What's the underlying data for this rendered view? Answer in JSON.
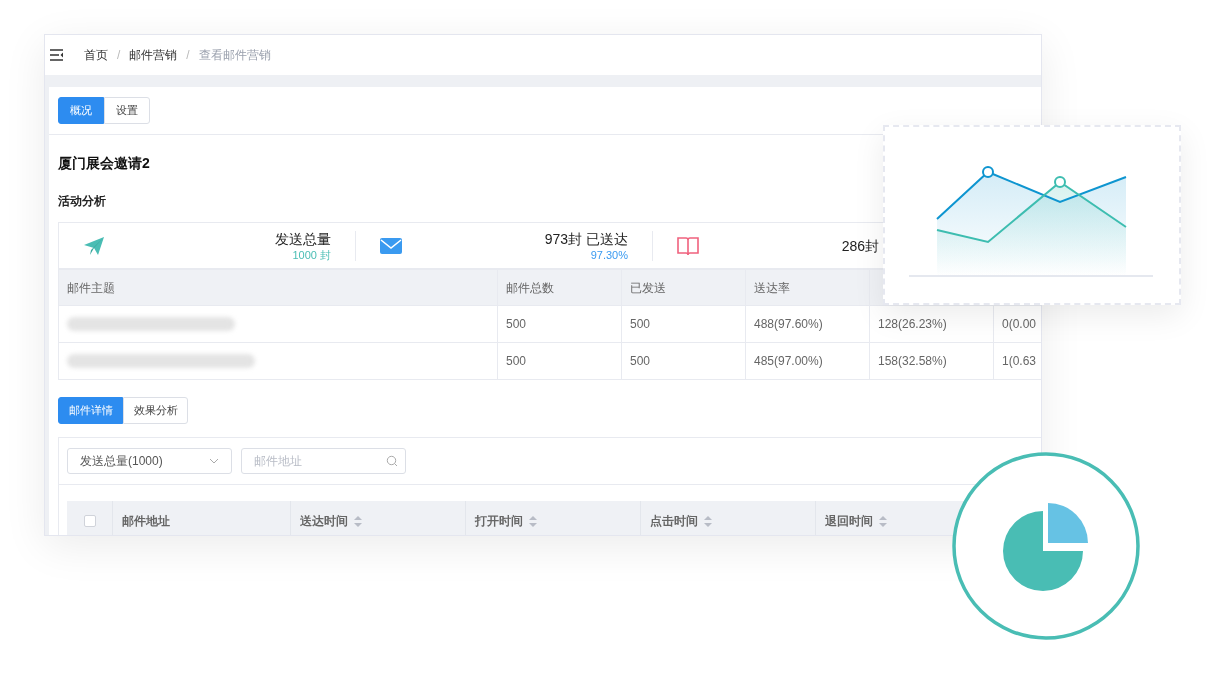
{
  "breadcrumb": [
    {
      "kind": "link",
      "label": "首页",
      "current": false
    },
    {
      "kind": "separator",
      "label": "/"
    },
    {
      "kind": "link",
      "label": "邮件营销",
      "current": false
    },
    {
      "kind": "separator",
      "label": "/"
    },
    {
      "kind": "link",
      "label": "查看邮件营销",
      "current": true
    }
  ],
  "tabs": [
    {
      "label": "概况",
      "selected": true
    },
    {
      "label": "设置",
      "selected": false
    }
  ],
  "title": "厦门展会邀请2",
  "section_title": "活动分析",
  "stats": [
    {
      "kind": "sent",
      "label": "发送总量",
      "sub": "1000 封",
      "color": "#4abdb4"
    },
    {
      "kind": "delivered",
      "label": "973封 已送达",
      "sub": "97.30%",
      "color": "#3a9af0"
    },
    {
      "kind": "opened",
      "label": "286封"
    }
  ],
  "summary_table": {
    "columns": [
      "邮件主题",
      "邮件总数",
      "已发送",
      "送达率"
    ],
    "rows": [
      {
        "cells": [
          "",
          "500",
          "500",
          "488(97.60%)",
          "128(26.23%)",
          "0(0.00"
        ]
      },
      {
        "cells": [
          "",
          "500",
          "500",
          "485(97.00%)",
          "158(32.58%)",
          "1(0.63"
        ]
      }
    ]
  },
  "detail_tabs": [
    {
      "label": "邮件详情",
      "selected": true
    },
    {
      "label": "效果分析",
      "selected": false
    }
  ],
  "filter": {
    "select": "发送总量(1000)",
    "search_placeholder": "邮件地址"
  },
  "detail_table": {
    "select_all_checked": false,
    "columns": [
      {
        "label": "邮件地址",
        "sortable": false
      },
      {
        "label": "送达时间",
        "sortable": true
      },
      {
        "label": "打开时间",
        "sortable": true
      },
      {
        "label": "点击时间",
        "sortable": true
      },
      {
        "label": "退回时间",
        "sortable": true
      }
    ]
  }
}
